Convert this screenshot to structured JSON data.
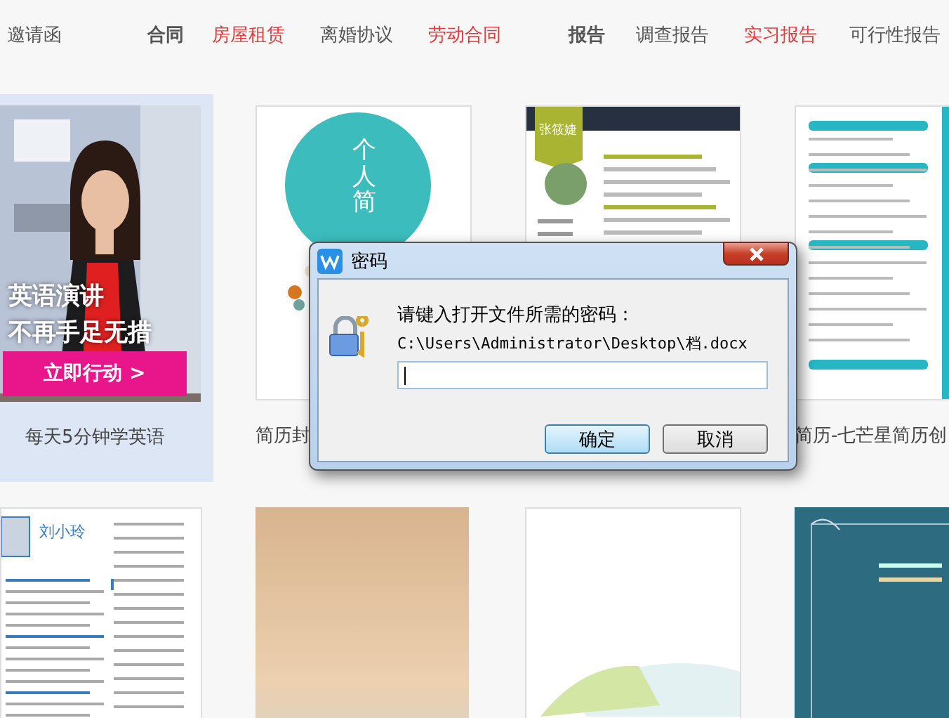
{
  "nav": {
    "items": [
      {
        "kind": "link",
        "label": "邀请函",
        "hot": false
      },
      {
        "kind": "heading",
        "label": "合同",
        "hot": false
      },
      {
        "kind": "link",
        "label": "房屋租赁",
        "hot": true
      },
      {
        "kind": "link",
        "label": "离婚协议",
        "hot": false
      },
      {
        "kind": "link",
        "label": "劳动合同",
        "hot": true
      },
      {
        "kind": "heading",
        "label": "报告",
        "hot": false
      },
      {
        "kind": "link",
        "label": "调查报告",
        "hot": false
      },
      {
        "kind": "link",
        "label": "实习报告",
        "hot": true
      },
      {
        "kind": "link",
        "label": "可行性报告",
        "hot": false
      }
    ]
  },
  "ad": {
    "headline": "英语演讲",
    "subline": "不再手足无措",
    "cta": "立即行动 >",
    "caption": "每天5分钟学英语"
  },
  "templates": [
    {
      "kind": "circle-cover",
      "title": "个人简",
      "caption": "简历封"
    },
    {
      "kind": "resume-dark",
      "name": "张筱婕"
    },
    {
      "kind": "resume-teal",
      "caption": "简历-七芒星简历创"
    },
    {
      "kind": "resume-blue",
      "name": "刘小玲"
    },
    {
      "kind": "photo-cover"
    },
    {
      "kind": "umbrella-cover"
    },
    {
      "kind": "teal-frame"
    }
  ],
  "dialog": {
    "title": "密码",
    "prompt": "请键入打开文件所需的密码：",
    "path": "C:\\Users\\Administrator\\Desktop\\档.docx",
    "buttons": [
      {
        "label": "确定",
        "default": true
      },
      {
        "label": "取消",
        "default": false
      }
    ]
  }
}
